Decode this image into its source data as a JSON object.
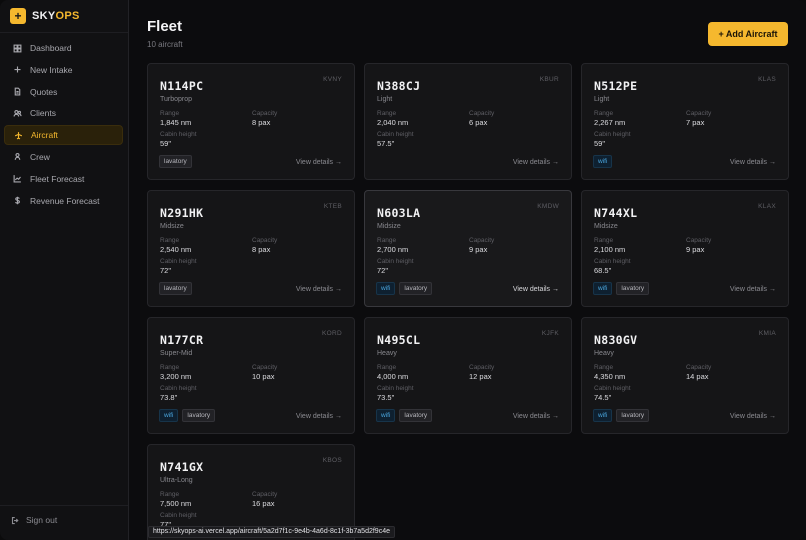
{
  "brand": {
    "name_part1": "SKY",
    "name_part2": "OPS",
    "logo_glyph": "+"
  },
  "sidebar": {
    "items": [
      {
        "label": "Dashboard",
        "icon": "grid-icon",
        "active": false
      },
      {
        "label": "New Intake",
        "icon": "plus-icon",
        "active": false
      },
      {
        "label": "Quotes",
        "icon": "document-icon",
        "active": false
      },
      {
        "label": "Clients",
        "icon": "users-icon",
        "active": false
      },
      {
        "label": "Aircraft",
        "icon": "plane-icon",
        "active": true
      },
      {
        "label": "Crew",
        "icon": "crew-icon",
        "active": false
      },
      {
        "label": "Fleet Forecast",
        "icon": "chart-icon",
        "active": false
      },
      {
        "label": "Revenue Forecast",
        "icon": "dollar-icon",
        "active": false
      }
    ],
    "signout_label": "Sign out"
  },
  "header": {
    "title": "Fleet",
    "subtitle": "10 aircraft",
    "add_label": "+ Add Aircraft"
  },
  "labels": {
    "range": "Range",
    "capacity": "Capacity",
    "cabin_height": "Cabin height",
    "view_details": "View details →"
  },
  "aircraft": [
    {
      "tail": "N114PC",
      "base": "KVNY",
      "class": "Turboprop",
      "range": "1,845 nm",
      "capacity": "8 pax",
      "cabin": "59\"",
      "tags": [
        "lavatory"
      ]
    },
    {
      "tail": "N388CJ",
      "base": "KBUR",
      "class": "Light",
      "range": "2,040 nm",
      "capacity": "6 pax",
      "cabin": "57.5\"",
      "tags": []
    },
    {
      "tail": "N512PE",
      "base": "KLAS",
      "class": "Light",
      "range": "2,267 nm",
      "capacity": "7 pax",
      "cabin": "59\"",
      "tags": [
        "wifi"
      ]
    },
    {
      "tail": "N291HK",
      "base": "KTEB",
      "class": "Midsize",
      "range": "2,540 nm",
      "capacity": "8 pax",
      "cabin": "72\"",
      "tags": [
        "lavatory"
      ]
    },
    {
      "tail": "N603LA",
      "base": "KMDW",
      "class": "Midsize",
      "range": "2,700 nm",
      "capacity": "9 pax",
      "cabin": "72\"",
      "tags": [
        "wifi",
        "lavatory"
      ]
    },
    {
      "tail": "N744XL",
      "base": "KLAX",
      "class": "Midsize",
      "range": "2,100 nm",
      "capacity": "9 pax",
      "cabin": "68.5\"",
      "tags": [
        "wifi",
        "lavatory"
      ]
    },
    {
      "tail": "N177CR",
      "base": "KORD",
      "class": "Super-Mid",
      "range": "3,200 nm",
      "capacity": "10 pax",
      "cabin": "73.8\"",
      "tags": [
        "wifi",
        "lavatory"
      ]
    },
    {
      "tail": "N495CL",
      "base": "KJFK",
      "class": "Heavy",
      "range": "4,000 nm",
      "capacity": "12 pax",
      "cabin": "73.5\"",
      "tags": [
        "wifi",
        "lavatory"
      ]
    },
    {
      "tail": "N830GV",
      "base": "KMIA",
      "class": "Heavy",
      "range": "4,350 nm",
      "capacity": "14 pax",
      "cabin": "74.5\"",
      "tags": [
        "wifi",
        "lavatory"
      ]
    },
    {
      "tail": "N741GX",
      "base": "KBOS",
      "class": "Ultra-Long",
      "range": "7,500 nm",
      "capacity": "16 pax",
      "cabin": "77\"",
      "tags": []
    }
  ],
  "hovered_index": 4,
  "status_url": "https://skyops-ai.vercel.app/aircraft/5a2d7f1c-9e4b-4a6d-8c1f-3b7a5d2f9c4e",
  "colors": {
    "accent": "#f5b82e",
    "wifi": "#4aa6de",
    "background": "#0c0c0e"
  }
}
